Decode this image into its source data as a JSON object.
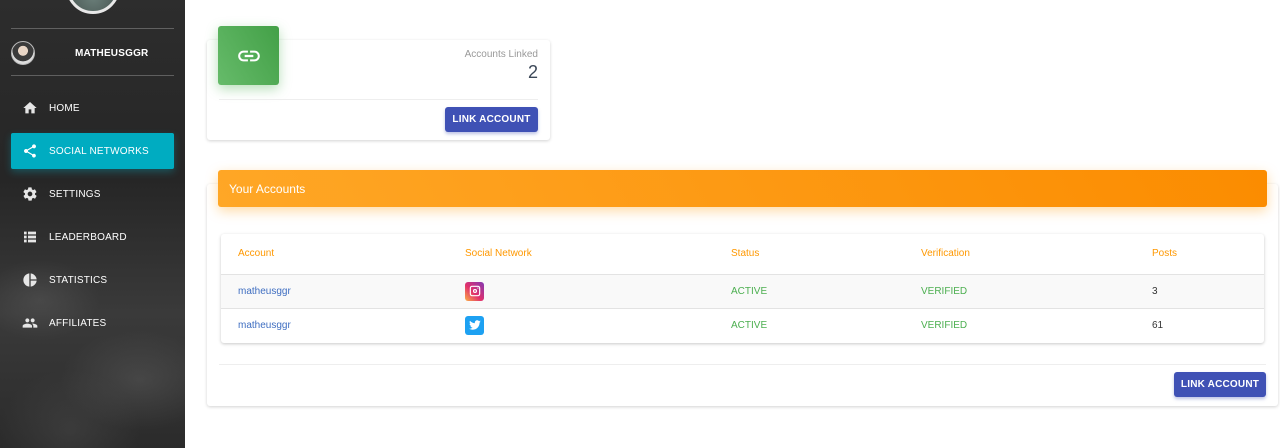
{
  "sidebar": {
    "user_name": "MATHEUSGGR",
    "items": [
      {
        "label": "HOME",
        "icon": "home-icon"
      },
      {
        "label": "SOCIAL NETWORKS",
        "icon": "share-icon",
        "active": true
      },
      {
        "label": "SETTINGS",
        "icon": "gear-icon"
      },
      {
        "label": "LEADERBOARD",
        "icon": "list-icon"
      },
      {
        "label": "STATISTICS",
        "icon": "pie-chart-icon"
      },
      {
        "label": "AFFILIATES",
        "icon": "people-icon"
      }
    ]
  },
  "stat_card": {
    "icon": "link-icon",
    "label": "Accounts Linked",
    "value": "2",
    "button_label": "LINK ACCOUNT"
  },
  "accounts": {
    "title": "Your Accounts",
    "columns": [
      "Account",
      "Social Network",
      "Status",
      "Verification",
      "Posts"
    ],
    "rows": [
      {
        "account": "matheusggr",
        "network_icon": "instagram-icon",
        "status": "ACTIVE",
        "verification": "VERIFIED",
        "posts": "3"
      },
      {
        "account": "matheusggr",
        "network_icon": "twitter-icon",
        "status": "ACTIVE",
        "verification": "VERIFIED",
        "posts": "61"
      }
    ],
    "button_label": "LINK ACCOUNT"
  },
  "colors": {
    "sidebar_active": "#00acc1",
    "stat_icon_bg": "#4caf50",
    "header_bg": "#fb8c00",
    "button_bg": "#3f51b5",
    "column_header": "#ff9800",
    "status_text": "#4caf50"
  }
}
